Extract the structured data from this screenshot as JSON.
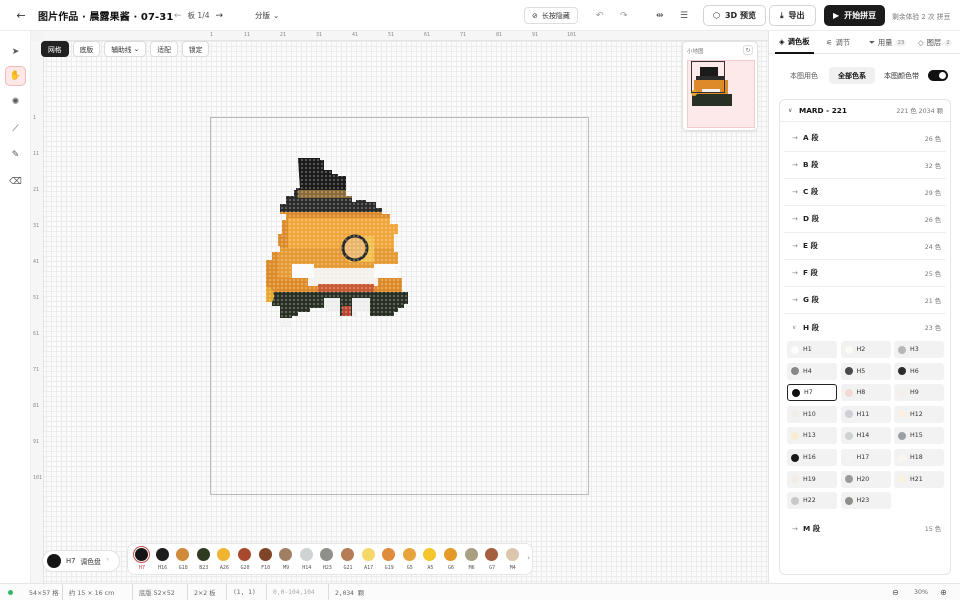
{
  "topbar": {
    "back_icon": "arrow-left-icon",
    "title": "图片作品 · 晨露果酱 · 07-31",
    "page_indicator": "板 1/4",
    "split_label": "分版",
    "hide_button": "长按隐藏",
    "preview_3d": "3D 预览",
    "export": "导出",
    "start": "开始拼豆",
    "trial_note": "剩余体验 2 次 拼豆"
  },
  "toolbar_chips": [
    "网格",
    "底版",
    "辅助线",
    "适配",
    "锁定"
  ],
  "ruler": {
    "top_ticks": [
      "1",
      "11",
      "21",
      "31",
      "41",
      "51",
      "61",
      "71",
      "81",
      "91",
      "101"
    ],
    "left_ticks": [
      "1",
      "11",
      "21",
      "31",
      "41",
      "51",
      "61",
      "71",
      "81",
      "91",
      "101"
    ]
  },
  "minimap": {
    "title": "小地图"
  },
  "palette_button": {
    "label": "H7",
    "text": "调色盘"
  },
  "palette_strip": [
    {
      "code": "H7",
      "color": "#151515"
    },
    {
      "code": "H16",
      "color": "#1d1d1d"
    },
    {
      "code": "G18",
      "color": "#d08a3a"
    },
    {
      "code": "B23",
      "color": "#2e3a22"
    },
    {
      "code": "A26",
      "color": "#f0b432"
    },
    {
      "code": "G20",
      "color": "#a8482c"
    },
    {
      "code": "F10",
      "color": "#7f4526"
    },
    {
      "code": "M9",
      "color": "#a07f62"
    },
    {
      "code": "H14",
      "color": "#cfd3d3"
    },
    {
      "code": "H23",
      "color": "#8f908c"
    },
    {
      "code": "G21",
      "color": "#b57c55"
    },
    {
      "code": "A17",
      "color": "#f6d76a"
    },
    {
      "code": "G19",
      "color": "#e08a3c"
    },
    {
      "code": "G5",
      "color": "#e7a43c"
    },
    {
      "code": "A5",
      "color": "#f4c52c"
    },
    {
      "code": "G6",
      "color": "#e39b25"
    },
    {
      "code": "M6",
      "color": "#a9a083"
    },
    {
      "code": "G7",
      "color": "#a75e3e"
    },
    {
      "code": "M4",
      "color": "#dcc6ad"
    }
  ],
  "panel": {
    "tabs": [
      {
        "label": "调色板",
        "count": ""
      },
      {
        "label": "调节",
        "count": ""
      },
      {
        "label": "用量",
        "count": "23"
      },
      {
        "label": "图层",
        "count": "2"
      }
    ],
    "seg_options": [
      "本图用色",
      "全部色系"
    ],
    "toggle_label": "本图颜色带",
    "brand": {
      "name": "MARD - 221",
      "meta": "221 色  2034 颗"
    },
    "segments": [
      {
        "label": "A 段",
        "count": "26 色"
      },
      {
        "label": "B 段",
        "count": "32 色"
      },
      {
        "label": "C 段",
        "count": "29 色"
      },
      {
        "label": "D 段",
        "count": "26 色"
      },
      {
        "label": "E 段",
        "count": "24 色"
      },
      {
        "label": "F 段",
        "count": "25 色"
      },
      {
        "label": "G 段",
        "count": "21 色"
      },
      {
        "label": "H 段",
        "count": "23 色"
      }
    ],
    "h_colors": [
      {
        "code": "H1",
        "color": "#fdfdfd"
      },
      {
        "code": "H2",
        "color": "#fbfaf5"
      },
      {
        "code": "H3",
        "color": "#b7b6b8"
      },
      {
        "code": "H4",
        "color": "#888888"
      },
      {
        "code": "H5",
        "color": "#4b4b4f"
      },
      {
        "code": "H6",
        "color": "#2c2c2c"
      },
      {
        "code": "H7",
        "color": "#111111"
      },
      {
        "code": "H8",
        "color": "#f3d9d6"
      },
      {
        "code": "H9",
        "color": "#f3f0ea"
      },
      {
        "code": "H10",
        "color": "#f0eeea"
      },
      {
        "code": "H11",
        "color": "#cfcfd5"
      },
      {
        "code": "H12",
        "color": "#fbf0e2"
      },
      {
        "code": "H13",
        "color": "#f7ecd3"
      },
      {
        "code": "H14",
        "color": "#cfd3d0"
      },
      {
        "code": "H15",
        "color": "#9aa0a4"
      },
      {
        "code": "H16",
        "color": "#1a1a1a"
      },
      {
        "code": "H17",
        "color": "#f4f4f4"
      },
      {
        "code": "H18",
        "color": "#faf6ef"
      },
      {
        "code": "H19",
        "color": "#f1eee8"
      },
      {
        "code": "H20",
        "color": "#9a9a98"
      },
      {
        "code": "H21",
        "color": "#f8f2dc"
      },
      {
        "code": "H22",
        "color": "#c8c8c8"
      },
      {
        "code": "H23",
        "color": "#8f8f8c"
      }
    ],
    "last_segment": {
      "label": "M 段",
      "count": "15 色"
    }
  },
  "status": {
    "grid": "54×57 格",
    "size": "约 15 × 16 cm",
    "board": "底版 52×52",
    "layout": "2×2 板",
    "coord": "(1, 1)",
    "range": "0,0-104,104",
    "beads": "2,034 颗",
    "zoom": "30%"
  }
}
